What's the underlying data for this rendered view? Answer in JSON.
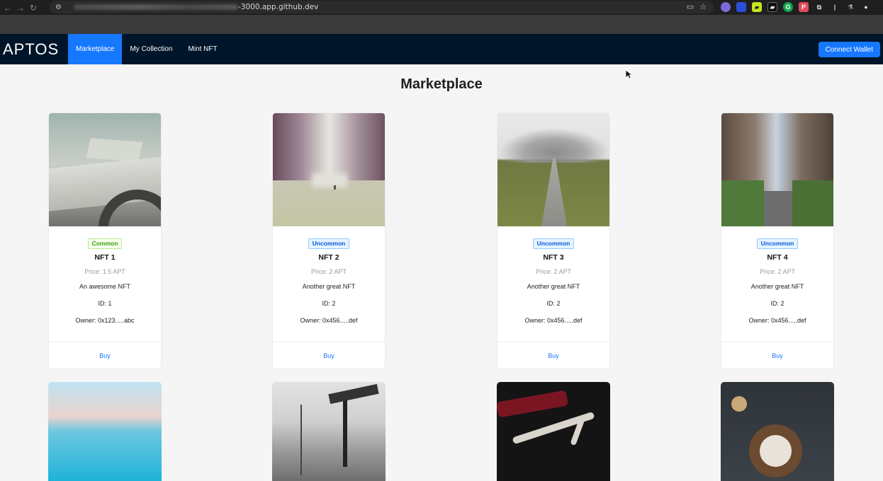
{
  "browser": {
    "url_suffix": "-3000.app.github.dev",
    "nav": {
      "back": "←",
      "forward": "→",
      "reload": "↻"
    }
  },
  "app": {
    "logo": "APTOS",
    "menu": [
      {
        "label": "Marketplace",
        "active": true
      },
      {
        "label": "My Collection",
        "active": false
      },
      {
        "label": "Mint NFT",
        "active": false
      }
    ],
    "connect_label": "Connect Wallet",
    "accent": "#1677ff",
    "navbar_bg": "#001529"
  },
  "page": {
    "title": "Marketplace",
    "cards": [
      {
        "rarity": "Common",
        "name": "NFT 1",
        "price": "Price: 1.5 APT",
        "description": "An awesome NFT",
        "id": "ID: 1",
        "owner": "Owner: 0x123.....abc",
        "buy": "Buy"
      },
      {
        "rarity": "Uncommon",
        "name": "NFT 2",
        "price": "Price: 2 APT",
        "description": "Another great NFT",
        "id": "ID: 2",
        "owner": "Owner: 0x456.....def",
        "buy": "Buy"
      },
      {
        "rarity": "Uncommon",
        "name": "NFT 3",
        "price": "Price: 2 APT",
        "description": "Another great NFT",
        "id": "ID: 2",
        "owner": "Owner: 0x456.....def",
        "buy": "Buy"
      },
      {
        "rarity": "Uncommon",
        "name": "NFT 4",
        "price": "Price: 2 APT",
        "description": "Another great NFT",
        "id": "ID: 2",
        "owner": "Owner: 0x456.....def",
        "buy": "Buy"
      }
    ]
  }
}
